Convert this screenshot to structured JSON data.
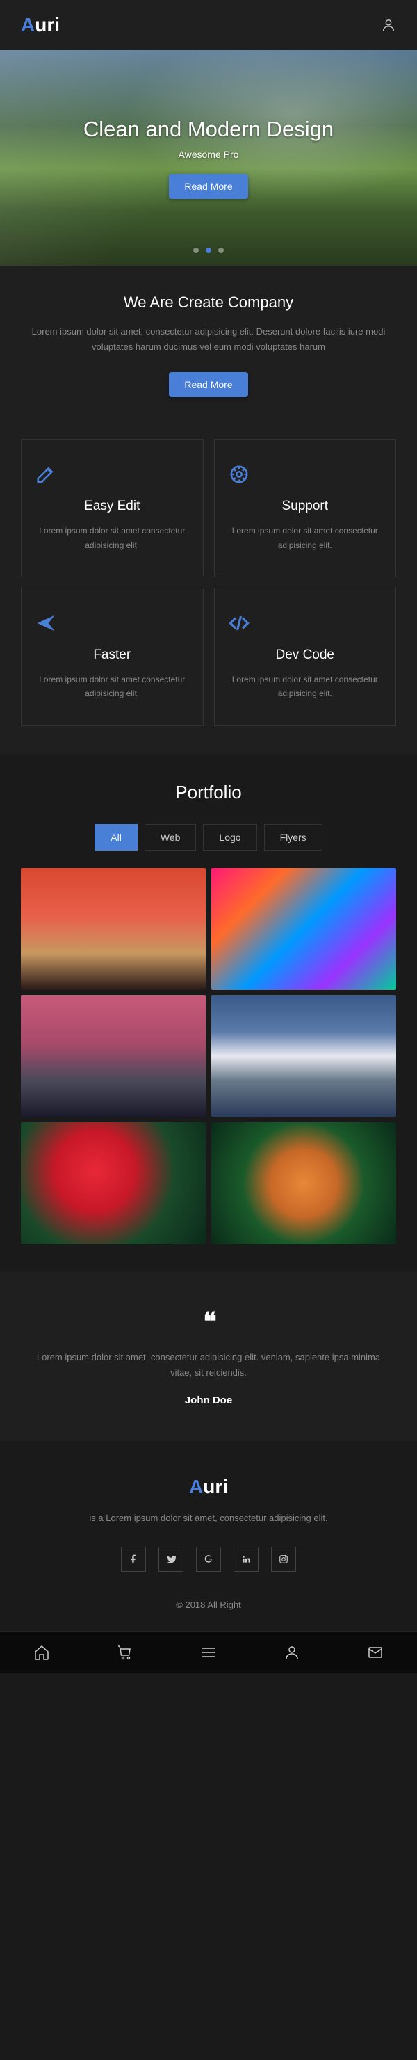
{
  "brand": {
    "accent": "A",
    "rest": "uri"
  },
  "hero": {
    "title": "Clean and Modern Design",
    "subtitle": "Awesome Pro",
    "button": "Read More"
  },
  "about": {
    "title": "We Are Create Company",
    "text": "Lorem ipsum dolor sit amet, consectetur adipisicing elit. Deserunt dolore facilis iure modi voluptates harum ducimus vel eum modi voluptates harum",
    "button": "Read More"
  },
  "features": [
    {
      "title": "Easy Edit",
      "text": "Lorem ipsum dolor sit amet consectetur adipisicing elit."
    },
    {
      "title": "Support",
      "text": "Lorem ipsum dolor sit amet consectetur adipisicing elit."
    },
    {
      "title": "Faster",
      "text": "Lorem ipsum dolor sit amet consectetur adipisicing elit."
    },
    {
      "title": "Dev Code",
      "text": "Lorem ipsum dolor sit amet consectetur adipisicing elit."
    }
  ],
  "portfolio": {
    "title": "Portfolio",
    "tabs": [
      "All",
      "Web",
      "Logo",
      "Flyers"
    ]
  },
  "testimonial": {
    "text": "Lorem ipsum dolor sit amet, consectetur adipisicing elit. veniam, sapiente ipsa minima vitae, sit reiciendis.",
    "author": "John Doe"
  },
  "footer": {
    "text": "is a Lorem ipsum dolor sit amet, consectetur adipisicing elit.",
    "copyright": "© 2018 All Right"
  }
}
